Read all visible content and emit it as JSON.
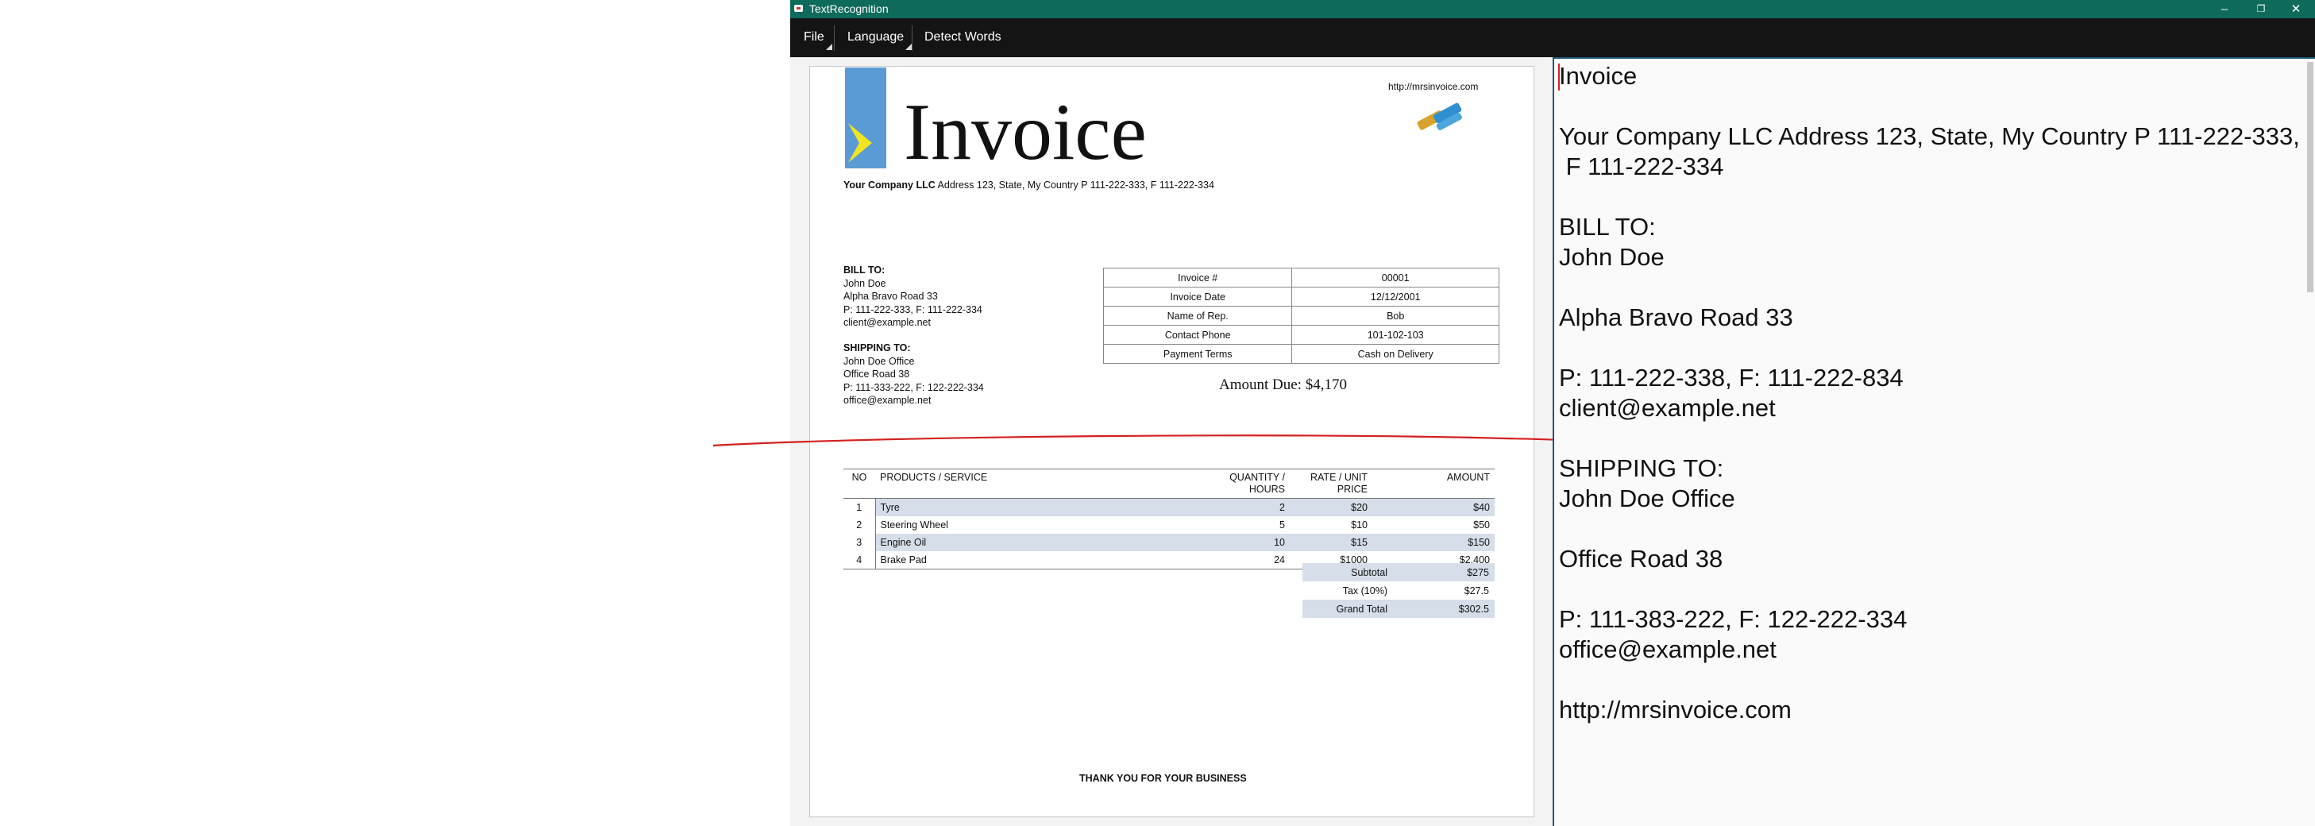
{
  "app": {
    "title": "TextRecognition",
    "window_buttons": {
      "minimize": "–",
      "restore": "❐",
      "close": "✕"
    }
  },
  "menu": {
    "file": "File",
    "language": "Language",
    "detect_words": "Detect Words"
  },
  "document": {
    "url": "http://mrsinvoice.com",
    "title": "Invoice",
    "company_name": "Your Company LLC",
    "company_address": "Address 123, State, My Country P 111-222-333, F 111-222-334",
    "bill_to": {
      "heading": "BILL TO:",
      "lines": [
        "John Doe",
        "Alpha Bravo Road 33",
        "P: 111-222-333, F: 111-222-334",
        "client@example.net"
      ]
    },
    "ship_to": {
      "heading": "SHIPPING TO:",
      "lines": [
        "John Doe Office",
        "Office Road 38",
        "P: 111-333-222, F: 122-222-334",
        "office@example.net"
      ]
    },
    "info_table": [
      {
        "label": "Invoice #",
        "value": "00001"
      },
      {
        "label": "Invoice Date",
        "value": "12/12/2001"
      },
      {
        "label": "Name of Rep.",
        "value": "Bob"
      },
      {
        "label": "Contact Phone",
        "value": "101-102-103"
      },
      {
        "label": "Payment Terms",
        "value": "Cash on Delivery"
      }
    ],
    "amount_due": "Amount Due: $4,170",
    "items_header": {
      "no": "NO",
      "product": "PRODUCTS / SERVICE",
      "qty": "QUANTITY / HOURS",
      "rate": "RATE / UNIT PRICE",
      "amount": "AMOUNT"
    },
    "items": [
      {
        "no": "1",
        "product": "Tyre",
        "qty": "2",
        "rate": "$20",
        "amount": "$40"
      },
      {
        "no": "2",
        "product": "Steering Wheel",
        "qty": "5",
        "rate": "$10",
        "amount": "$50"
      },
      {
        "no": "3",
        "product": "Engine Oil",
        "qty": "10",
        "rate": "$15",
        "amount": "$150"
      },
      {
        "no": "4",
        "product": "Brake Pad",
        "qty": "24",
        "rate": "$1000",
        "amount": "$2,400"
      }
    ],
    "totals": [
      {
        "label": "Subtotal",
        "value": "$275"
      },
      {
        "label": "Tax (10%)",
        "value": "$27.5"
      },
      {
        "label": "Grand Total",
        "value": "$302.5"
      }
    ],
    "thank_you": "THANK YOU FOR YOUR BUSINESS"
  },
  "recognized_text": [
    "Invoice",
    "",
    "Your Company LLC Address 123, State, My Country P 111-222-333,",
    " F 111-222-334",
    "",
    "BILL TO:",
    "John Doe",
    "",
    "Alpha Bravo Road 33",
    "",
    "P: 111-222-338, F: 111-222-834",
    "client@example.net",
    "",
    "SHIPPING TO:",
    "John Doe Office",
    "",
    "Office Road 38",
    "",
    "P: 111-383-222, F: 122-222-334",
    "office@example.net",
    "",
    "http://mrsinvoice.com"
  ],
  "colors": {
    "titlebar": "#0e6a5a",
    "menubar": "#141414",
    "annotation_stroke": "#d42020",
    "logo_blue": "#5b9bd5",
    "logo_yellow": "#f1e61e",
    "table_shade": "#d6dee9"
  }
}
